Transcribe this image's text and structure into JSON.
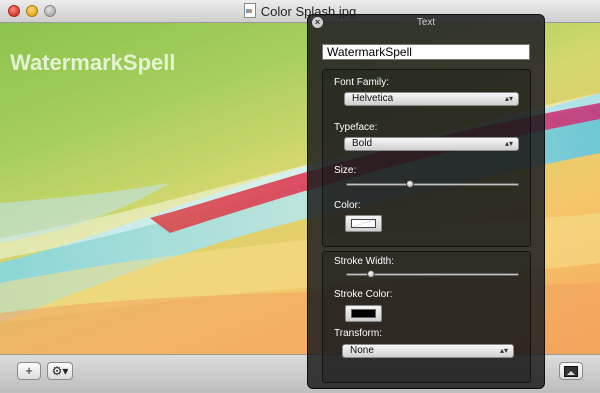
{
  "window": {
    "title": "Color Splash.jpg"
  },
  "canvas": {
    "watermark_text": "WatermarkSpell"
  },
  "hud": {
    "title": "Text",
    "text_value": "WatermarkSpell",
    "font_family_label": "Font Family:",
    "font_family_value": "Helvetica",
    "typeface_label": "Typeface:",
    "typeface_value": "Bold",
    "size_label": "Size:",
    "size_level": 0.36,
    "color_label": "Color:",
    "stroke_width_label": "Stroke Width:",
    "stroke_width_level": 0.12,
    "stroke_color_label": "Stroke Color:",
    "transform_label": "Transform:",
    "transform_value": "None"
  },
  "toolbar": {
    "add_label": "+",
    "gear_label": "⚙▾"
  },
  "colors": {
    "hud_bg": "#212121",
    "text_color": "#ffffff",
    "stroke_color": "#000000"
  }
}
